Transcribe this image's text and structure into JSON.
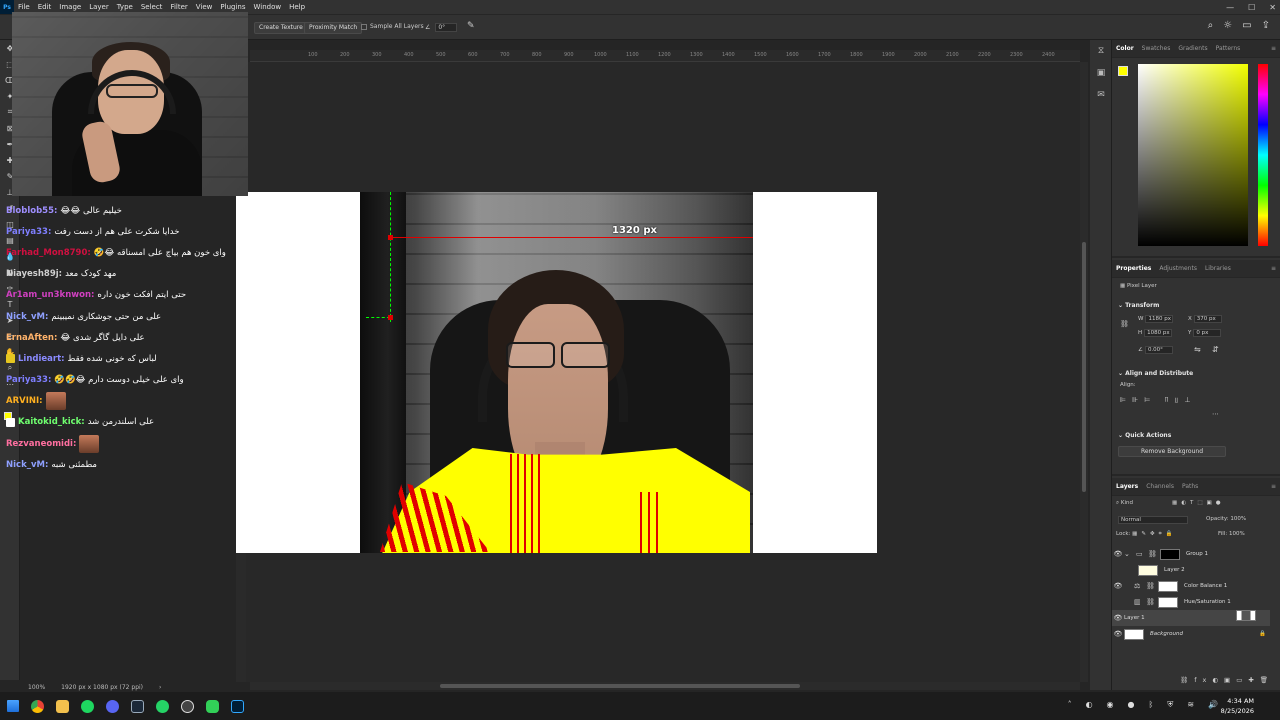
{
  "menubar": {
    "logo": "Ps",
    "items": [
      "File",
      "Edit",
      "Image",
      "Layer",
      "Type",
      "Select",
      "Filter",
      "View",
      "Plugins",
      "Window",
      "Help"
    ]
  },
  "options": {
    "create_texture": "Create Texture",
    "proximity_match": "Proximity Match",
    "sample_all_layers": "Sample All Layers",
    "angle": "0°"
  },
  "ruler": {
    "ticks": [
      "100",
      "200",
      "300",
      "400",
      "500",
      "600",
      "700",
      "800",
      "900",
      "1000",
      "1100",
      "1200",
      "1300",
      "1400",
      "1500",
      "1600",
      "1700",
      "1800",
      "1900",
      "2000",
      "2100",
      "2200",
      "2300",
      "2400"
    ]
  },
  "canvas": {
    "measure_label": "1320 px"
  },
  "chat": [
    {
      "user": "Bloblob55:",
      "msg": "خیلیم عالی 😂😂",
      "color": "#9f8fff"
    },
    {
      "user": "Pariya33:",
      "msg": "خدایا شکرت علی هم از دست رفت",
      "color": "#7f7fff"
    },
    {
      "user": "Farhad_Mon8790:",
      "msg": "وای خون هم بیاچ علی امسناقه 😂🤣",
      "color": "#d01040"
    },
    {
      "user": "Niayesh89j:",
      "msg": "مهد کودک معد",
      "color": "#cfcfcf"
    },
    {
      "user": "Ar1am_un3knwon:",
      "msg": "حتی ایتم افکت خون داره",
      "color": "#d040c0"
    },
    {
      "user": "Nick_vM:",
      "msg": "علی من حتی جوشکاری نمیبینم",
      "color": "#8fa0ff"
    },
    {
      "user": "ErnaAften:",
      "msg": "علی دایل گاگر شدی 😂",
      "color": "#ffb36b"
    },
    {
      "user": "Lindieart:",
      "msg": "لباس که خونی شده فقط",
      "color": "#8a8aff"
    },
    {
      "user": "Pariya33:",
      "msg": "وای علی خیلی دوست دارم 😂🤣🤣",
      "color": "#7f7fff"
    },
    {
      "user": "ARVINI:",
      "msg": "",
      "color": "#ffb020"
    },
    {
      "user": "Kaitokid_kick:",
      "msg": "علی اسلندرمن شد",
      "color": "#6fff6f"
    },
    {
      "user": "Rezvaneomidi:",
      "msg": "",
      "color": "#ff6fa0"
    },
    {
      "user": "Nick_vM:",
      "msg": "مطمئنی شبه",
      "color": "#8fa0ff"
    }
  ],
  "status": {
    "zoom": "100%",
    "doc_info": "1920 px x 1080 px (72 ppi)"
  },
  "color_panel": {
    "tabs": [
      "Color",
      "Swatches",
      "Gradients",
      "Patterns"
    ],
    "fg": "#ffff00",
    "bg": "#ffffff"
  },
  "properties": {
    "tabs": [
      "Properties",
      "Adjustments",
      "Libraries"
    ],
    "layer_kind": "Pixel Layer",
    "transform_title": "Transform",
    "w_label": "W",
    "w": "1180 px",
    "h_label": "H",
    "h": "1080 px",
    "x_label": "X",
    "x": "370 px",
    "y_label": "Y",
    "y": "0 px",
    "angle": "0.00°",
    "align_title": "Align and Distribute",
    "align_label": "Align:",
    "quick_actions_title": "Quick Actions",
    "remove_bg": "Remove Background"
  },
  "layers": {
    "tabs": [
      "Layers",
      "Channels",
      "Paths"
    ],
    "kind": "Kind",
    "blend": "Normal",
    "opacity_label": "Opacity:",
    "opacity": "100%",
    "lock_label": "Lock:",
    "fill_label": "Fill:",
    "fill": "100%",
    "items": [
      {
        "name": "Group 1"
      },
      {
        "name": "Layer 2"
      },
      {
        "name": "Color Balance 1"
      },
      {
        "name": "Hue/Saturation 1"
      },
      {
        "name": "Layer 1"
      },
      {
        "name": "Background"
      }
    ]
  },
  "clock": {
    "time": "4:34 AM",
    "date": "8/25/2026"
  }
}
